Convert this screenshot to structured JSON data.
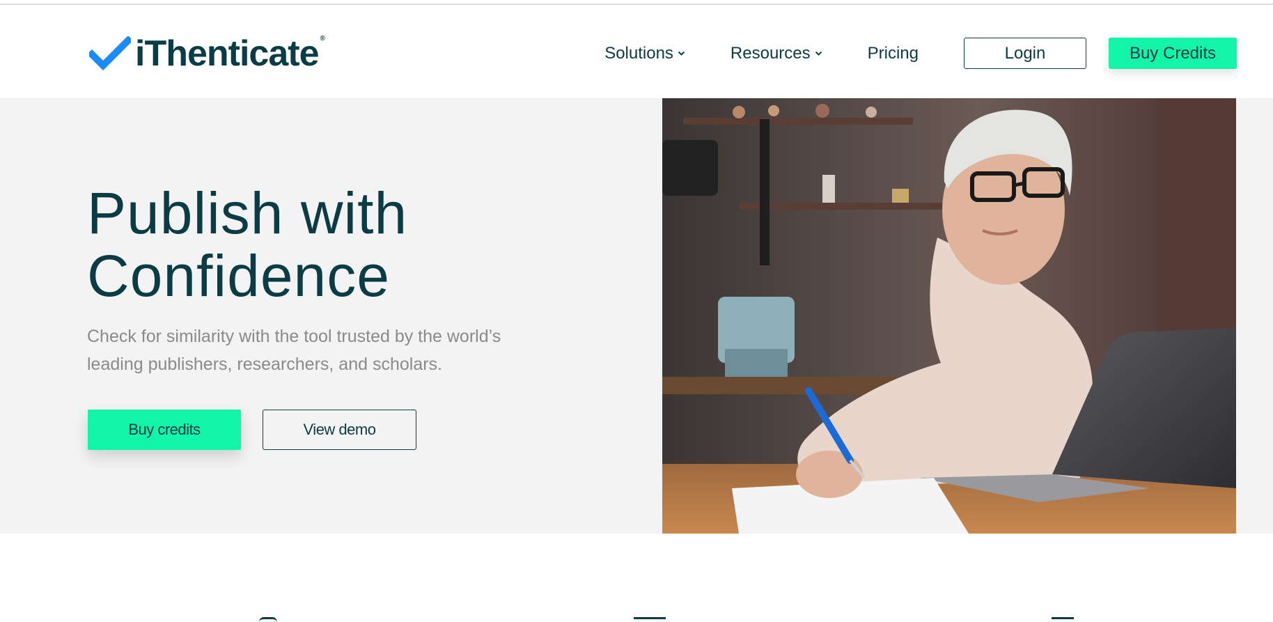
{
  "brand": {
    "name": "iThenticate",
    "reg_mark": "®",
    "logo_icon": "checkmark-icon",
    "accent_color": "#12f5a8",
    "check_color": "#1a8cff",
    "text_color": "#0b3b45"
  },
  "nav": {
    "solutions": "Solutions",
    "resources": "Resources",
    "pricing": "Pricing",
    "login": "Login",
    "buy_credits": "Buy Credits"
  },
  "hero": {
    "title_line1": "Publish with",
    "title_line2": "Confidence",
    "subtitle_line1": "Check for similarity with the tool trusted by the world’s",
    "subtitle_line2": "leading publishers, researchers, and scholars.",
    "primary_button": "Buy credits",
    "secondary_button": "View demo",
    "image_icon": "woman-with-laptop-photo"
  }
}
